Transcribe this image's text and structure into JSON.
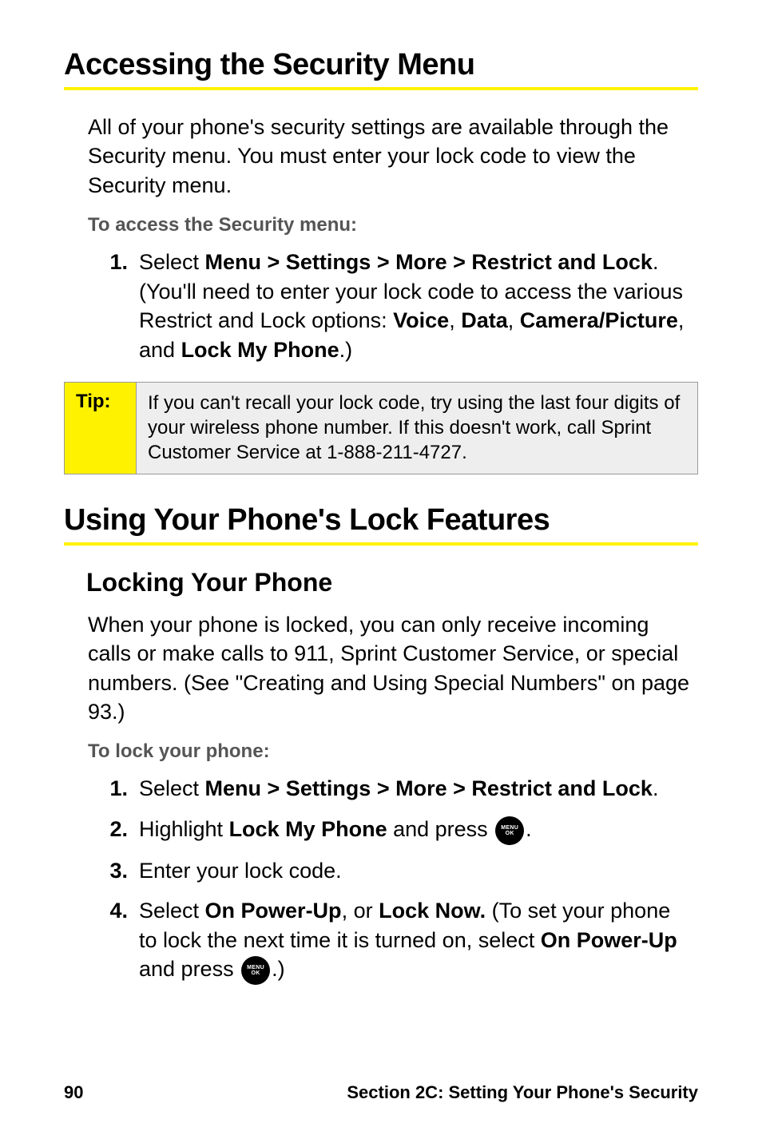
{
  "h1a": "Accessing the Security Menu",
  "intro": "All of your phone's security settings are available through the Security menu. You must enter your lock code to view the Security menu.",
  "sub1": "To access the Security menu:",
  "s1_num": "1.",
  "s1_pre": "Select ",
  "s1_b1": "Menu > Settings > More > Restrict and Lock",
  "s1_mid1": ". (You'll need to enter your lock code to access the various Restrict and Lock options: ",
  "s1_b2": "Voice",
  "s1_c1": ", ",
  "s1_b3": "Data",
  "s1_c2": ", ",
  "s1_b4": "Camera/Picture",
  "s1_c3": ", and ",
  "s1_b5": "Lock My Phone",
  "s1_end": ".)",
  "tip_label": "Tip:",
  "tip_text": "If you can't recall your lock code, try using the last four digits of your wireless phone number. If this doesn't work, call Sprint Customer Service at 1-888-211-4727.",
  "h1b": "Using Your Phone's Lock Features",
  "h2": "Locking Your Phone",
  "p2": "When your phone is locked, you can only receive incoming calls or make calls to 911, Sprint Customer Service, or special numbers. (See \"Creating and Using Special Numbers\" on page 93.)",
  "sub2": "To lock your phone:",
  "l1_num": "1.",
  "l1_pre": "Select ",
  "l1_b1": "Menu > Settings > More > Restrict and Lock",
  "l1_end": ".",
  "l2_num": "2.",
  "l2_pre": "Highlight ",
  "l2_b1": "Lock My Phone",
  "l2_mid": " and press ",
  "l2_end": ".",
  "l3_num": "3.",
  "l3_text": "Enter your lock code.",
  "l4_num": "4.",
  "l4_pre": "Select ",
  "l4_b1": "On Power-Up",
  "l4_c1": ", or ",
  "l4_b2": "Lock Now.",
  "l4_mid": " (To set your phone to lock the next time it is turned on, select ",
  "l4_b3": "On Power-Up",
  "l4_mid2": " and press ",
  "l4_end": ".)",
  "key_top": "MENU",
  "key_bot": "OK",
  "footer_left": "90",
  "footer_right": "Section 2C: Setting Your Phone's Security"
}
